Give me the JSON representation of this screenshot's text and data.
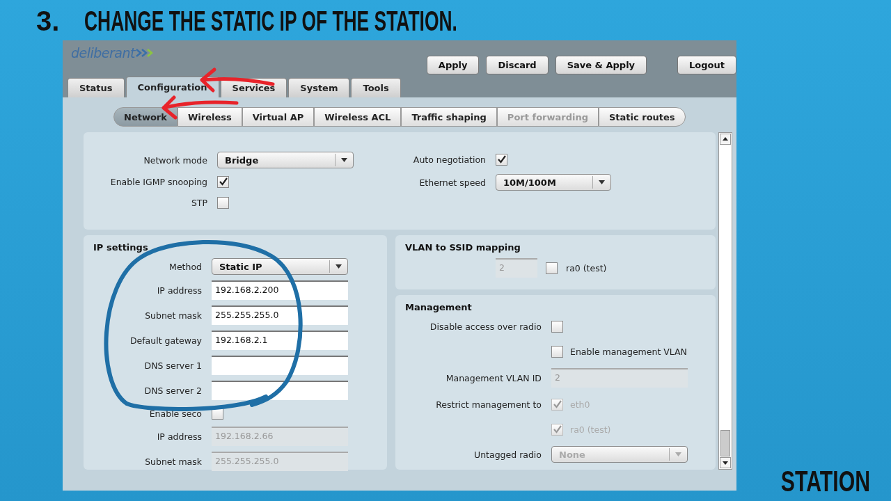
{
  "heading": {
    "step": "3.",
    "title": "CHANGE THE STATIC IP OF THE STATION."
  },
  "app": {
    "logo": "deliberant",
    "actions": [
      "Apply",
      "Discard",
      "Save & Apply",
      "Logout"
    ],
    "tabs": [
      {
        "label": "Status",
        "selected": false
      },
      {
        "label": "Configuration",
        "selected": true
      },
      {
        "label": "Services",
        "selected": false
      },
      {
        "label": "System",
        "selected": false
      },
      {
        "label": "Tools",
        "selected": false
      }
    ],
    "subtabs": [
      {
        "label": "Network",
        "selected": true,
        "disabled": false
      },
      {
        "label": "Wireless",
        "selected": false,
        "disabled": false
      },
      {
        "label": "Virtual AP",
        "selected": false,
        "disabled": false
      },
      {
        "label": "Wireless ACL",
        "selected": false,
        "disabled": false
      },
      {
        "label": "Traffic shaping",
        "selected": false,
        "disabled": false
      },
      {
        "label": "Port forwarding",
        "selected": false,
        "disabled": true
      },
      {
        "label": "Static routes",
        "selected": false,
        "disabled": false
      }
    ],
    "general_left": [
      {
        "kind": "select",
        "label": "Network mode",
        "value": "Bridge",
        "disabled": false
      },
      {
        "kind": "checkbox",
        "label": "Enable IGMP snooping",
        "checked": true,
        "disabled": false
      },
      {
        "kind": "checkbox",
        "label": "STP",
        "checked": false,
        "disabled": false
      }
    ],
    "general_right": [
      {
        "kind": "checkbox",
        "label": "Auto negotiation",
        "checked": true,
        "disabled": false
      },
      {
        "kind": "select",
        "label": "Ethernet speed",
        "value": "10M/100M",
        "disabled": false
      }
    ],
    "ip_settings": {
      "title": "IP settings",
      "rows": [
        {
          "kind": "select",
          "label": "Method",
          "value": "Static IP",
          "disabled": false
        },
        {
          "kind": "input",
          "label": "IP address",
          "value": "192.168.2.200",
          "disabled": false
        },
        {
          "kind": "input",
          "label": "Subnet mask",
          "value": "255.255.255.0",
          "disabled": false
        },
        {
          "kind": "input",
          "label": "Default gateway",
          "value": "192.168.2.1",
          "disabled": false
        },
        {
          "kind": "input",
          "label": "DNS server 1",
          "disabled": false
        },
        {
          "kind": "input",
          "label": "DNS server 2",
          "disabled": false
        },
        {
          "kind": "checkbox",
          "label": "Enable seco",
          "checked": false,
          "disabled": false
        },
        {
          "kind": "input",
          "label": "IP address",
          "value": "192.168.2.66",
          "disabled": true
        },
        {
          "kind": "input",
          "label": "Subnet mask",
          "value": "255.255.255.0",
          "disabled": true
        }
      ]
    },
    "vlan_mapping": {
      "title": "VLAN to SSID mapping",
      "value": "2",
      "option": "ra0 (test)",
      "checked": false
    },
    "management": {
      "title": "Management",
      "rows": [
        {
          "kind": "checkbox",
          "label": "Disable access over radio",
          "checked": false,
          "disabled": false
        },
        {
          "kind": "checkbox",
          "option": "Enable management VLAN",
          "checked": false,
          "disabled": false
        },
        {
          "kind": "input",
          "label": "Management VLAN ID",
          "value": "2",
          "disabled": true
        },
        {
          "kind": "checkbox",
          "label": "Restrict management to",
          "option": "eth0",
          "checked": true,
          "disabled": true
        },
        {
          "kind": "checkbox",
          "option": "ra0 (test)",
          "checked": true,
          "disabled": true
        },
        {
          "kind": "select",
          "label": "Untagged radio",
          "value": "None",
          "disabled": true
        }
      ]
    }
  },
  "corner_label": "STATION"
}
